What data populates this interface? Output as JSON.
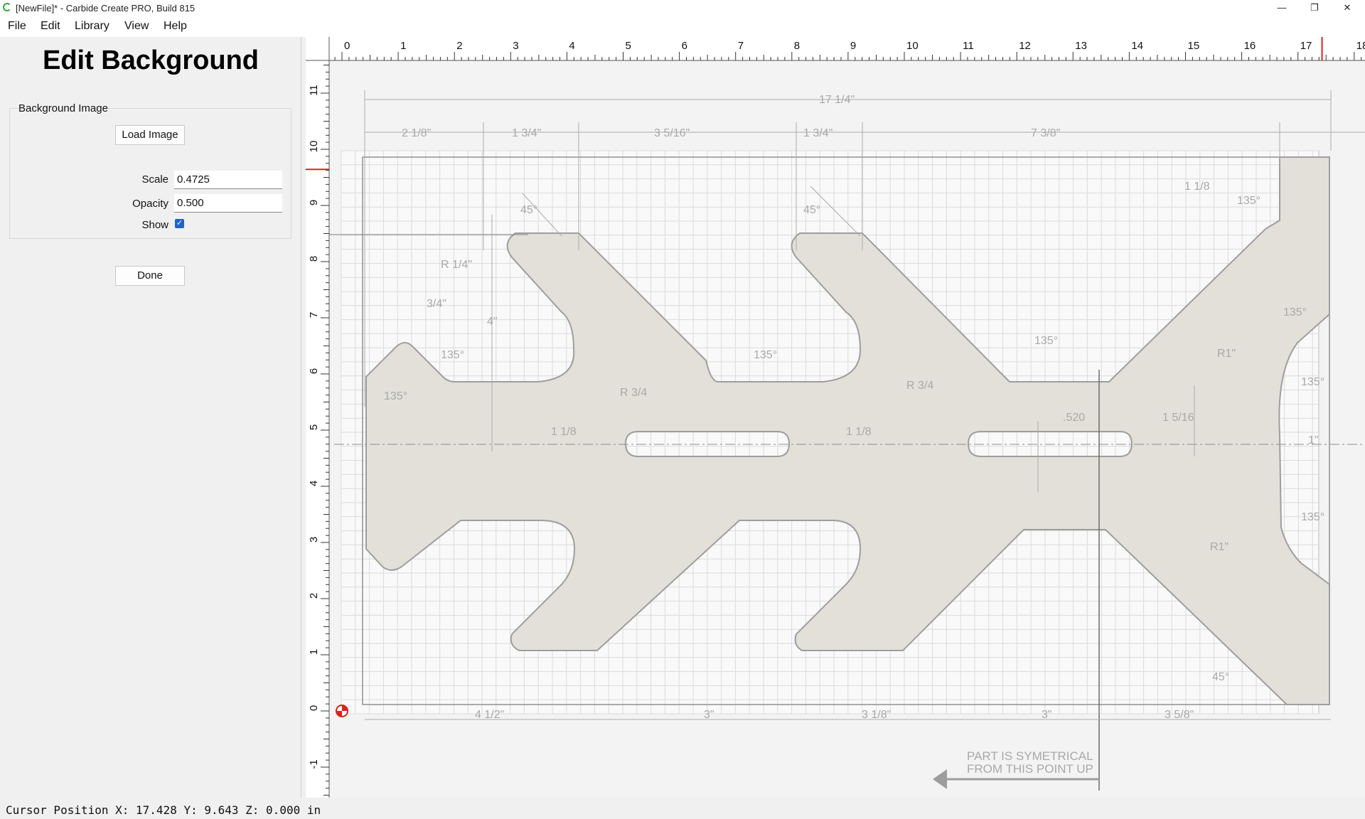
{
  "window": {
    "title": "[NewFile]* - Carbide Create PRO, Build 815",
    "minimize": "—",
    "restore": "❐",
    "close": "✕"
  },
  "menu": {
    "items": [
      {
        "label": "File"
      },
      {
        "label": "Edit"
      },
      {
        "label": "Library"
      },
      {
        "label": "View"
      },
      {
        "label": "Help"
      }
    ]
  },
  "panel": {
    "title": "Edit Background",
    "group_title": "Background Image",
    "load_button": "Load Image",
    "scale_label": "Scale",
    "scale_value": "0.4725",
    "opacity_label": "Opacity",
    "opacity_value": "0.500",
    "show_label": "Show",
    "show_checked": true,
    "done_button": "Done"
  },
  "rulers": {
    "top_labels": [
      "0",
      "1",
      "2",
      "3",
      "4",
      "5",
      "6",
      "7",
      "8",
      "9",
      "10",
      "11",
      "12",
      "13",
      "14",
      "15",
      "16",
      "17",
      "18"
    ],
    "left_labels": [
      "11",
      "10",
      "9",
      "8",
      "7",
      "6",
      "5",
      "4",
      "3",
      "2",
      "1",
      "0",
      "-1"
    ],
    "cursor_x": 17.428,
    "cursor_y": 9.643
  },
  "drawing_text": {
    "dim_total": "17 1/4\"",
    "dim_a": "2 1/8\"",
    "dim_b": "1 3/4\"",
    "dim_c": "3 5/16\"",
    "dim_d": "1 3/4\"",
    "dim_e": "7 3/8\"",
    "dim_f": "1 1/8",
    "dim_g": "3/4\"",
    "dim_h": "4\"",
    "dim_r": "R 1/4\"",
    "dim_r2": "R 3/4",
    "dim_r3": "R 3/4",
    "dim_slot1": "1 1/8",
    "dim_slot2": "1 1/8",
    "dim_520": ".520",
    "dim_1516": "1 5/16",
    "dim_1in": "1\"",
    "angle_135": "135°",
    "angle_45": "45°",
    "r1": "R1\"",
    "bot_a": "4 1/2\"",
    "bot_b": "3\"",
    "bot_c": "3 1/8\"",
    "bot_d": "3\"",
    "bot_e": "3 5/8\"",
    "note_line1": "PART IS SYMETRICAL",
    "note_line2": "FROM THIS POINT UP"
  },
  "status": {
    "text": "Cursor Position X: 17.428 Y: 9.643 Z: 0.000 in"
  },
  "colors": {
    "accent_checkbox": "#1e63c8",
    "cursor_marker": "#e02020",
    "part_fill": "#e2dfd8",
    "grid": "#d9d9d9"
  }
}
